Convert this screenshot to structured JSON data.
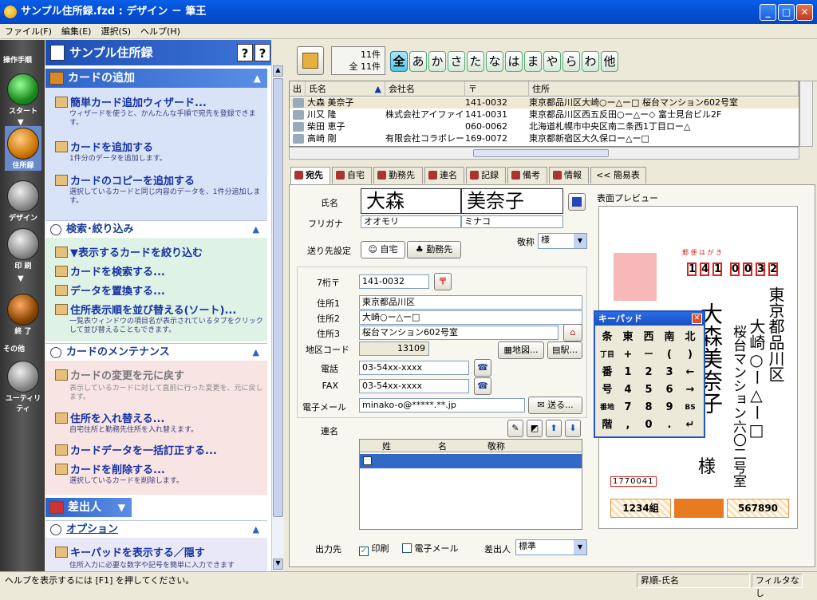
{
  "window": {
    "title": "サンプル住所録.fzd : デザイン － 筆王"
  },
  "menu": [
    "ファイル(F)",
    "編集(E)",
    "選択(S)",
    "ヘルプ(H)"
  ],
  "strip": {
    "section1": "操作手順",
    "start": "スタート",
    "addressbook": "住所録",
    "design": "デザイン",
    "print": "印 刷",
    "end": "終 了",
    "section2": "その他",
    "utility": "ユーティリティ"
  },
  "taskpane": {
    "title": "サンプル住所録",
    "add": {
      "header": "カードの追加",
      "wizard": "簡単カード追加ウィザード...",
      "wizard_desc": "ウィザードを使うと、かんたんな手順で宛先を登録できます。",
      "add_card": "カードを追加する",
      "add_card_desc": "1件分のデータを追加します。",
      "copy_card": "カードのコピーを追加する",
      "copy_card_desc": "選択しているカードと同じ内容のデータを、1件分追加します。"
    },
    "search": {
      "header": "検索･絞り込み",
      "filter": "▼表示するカードを絞り込む",
      "find": "カードを検索する...",
      "replace": "データを置換する...",
      "sort": "住所表示順を並び替える(ソート)...",
      "sort_desc": "一覧表ウィンドウの項目名が表示されているタブをクリックして並び替えることもできます。"
    },
    "maint": {
      "header": "カードのメンテナンス",
      "undo": "カードの変更を元に戻す",
      "undo_desc": "表示しているカードに対して直前に行った変更を、元に戻します。",
      "swap": "住所を入れ替える...",
      "swap_desc": "自宅住所と勤務先住所を入れ替えます。",
      "bulk": "カードデータを一括訂正する...",
      "delete": "カードを削除する...",
      "delete_desc": "選択しているカードを削除します。"
    },
    "sender": {
      "header": "差出人"
    },
    "option": {
      "header": "オプション",
      "keypad": "キーパッドを表示する／隠す",
      "keypad_desc": "住所入力に必要な数字や記号を簡単に入力できます"
    }
  },
  "count": {
    "line1": "11件",
    "line2": "全 11件"
  },
  "kana": [
    "全",
    "あ",
    "か",
    "さ",
    "た",
    "な",
    "は",
    "ま",
    "や",
    "ら",
    "わ",
    "他"
  ],
  "grid": {
    "headers": [
      "出",
      "氏名",
      "会社名",
      "〒",
      "住所"
    ],
    "rows": [
      {
        "name": "大森 美奈子",
        "company": "",
        "zip": "141-0032",
        "address": "東京都品川区大崎○ー△ー□ 桜台マンション602号室"
      },
      {
        "name": "川又 隆",
        "company": "株式会社アイファイブ",
        "zip": "141-0031",
        "address": "東京都品川区西五反田○ー△ー◇ 富士見台ビル2F"
      },
      {
        "name": "柴田 恵子",
        "company": "",
        "zip": "060-0062",
        "address": "北海道札幌市中央区南二条西1丁目ロー△"
      },
      {
        "name": "高崎 剛",
        "company": "有限会社コラボレー...",
        "zip": "169-0072",
        "address": "東京都新宿区大久保ロー△ー□"
      }
    ]
  },
  "tabs": [
    "宛先",
    "自宅",
    "勤務先",
    "連名",
    "記録",
    "備考",
    "情報",
    "<< 簡易表示"
  ],
  "form": {
    "name_label": "氏名",
    "last_name": "大森",
    "first_name": "美奈子",
    "furigana_label": "フリガナ",
    "last_kana": "オオモリ",
    "first_kana": "ミナコ",
    "dest_label": "送り先設定",
    "dest_home": "自宅",
    "dest_work": "勤務先",
    "honorific_label": "敬称",
    "honorific": "様",
    "zip_label": "7桁〒",
    "zip": "141-0032",
    "addr1_label": "住所1",
    "addr1": "東京都品川区",
    "addr2_label": "住所2",
    "addr2": "大崎○ー△ー□",
    "addr3_label": "住所3",
    "addr3": "桜台マンション602号室",
    "area_label": "地区コード",
    "area": "13109",
    "map_btn": "地図...",
    "station_btn": "駅...",
    "tel_label": "電話",
    "tel": "03-54xx-xxxx",
    "fax_label": "FAX",
    "fax": "03-54xx-xxxx",
    "email_label": "電子メール",
    "email": "minako-o@*****.**.jp",
    "send_btn": "送る...",
    "joint_label": "連名",
    "joint_cols": [
      "姓",
      "名",
      "敬称"
    ],
    "output_label": "出力先",
    "print_check": "印刷",
    "email_check": "電子メール",
    "sender_label": "差出人",
    "sender": "標準"
  },
  "preview": {
    "label": "表面プレビュー",
    "zip_digits": [
      "1",
      "4",
      "1",
      "0",
      "0",
      "3",
      "2"
    ],
    "address_line1": "東京都品川区",
    "address_line2": "大崎○ー△ー□",
    "address_line3": "桜台マンション六〇二号室",
    "addressee": "大森美奈子",
    "honorific": "様",
    "sender_zip": "1770041",
    "postcard_header": "郵 便 は が き",
    "lottery_left": "1234組",
    "lottery_right": "567890"
  },
  "keypad": {
    "title": "キーパッド",
    "keys": [
      [
        "条",
        "東",
        "西",
        "南",
        "北"
      ],
      [
        "丁目",
        "+",
        "－",
        "(",
        ")"
      ],
      [
        "番",
        "1",
        "2",
        "3",
        "←"
      ],
      [
        "号",
        "4",
        "5",
        "6",
        "→"
      ],
      [
        "番地",
        "7",
        "8",
        "9",
        "BS"
      ],
      [
        "階",
        ",",
        "0",
        ".",
        "↵"
      ]
    ]
  },
  "status": {
    "help": "ヘルプを表示するには [F1] を押してください。",
    "sort": "昇順-氏名",
    "filter": "フィルタなし"
  }
}
